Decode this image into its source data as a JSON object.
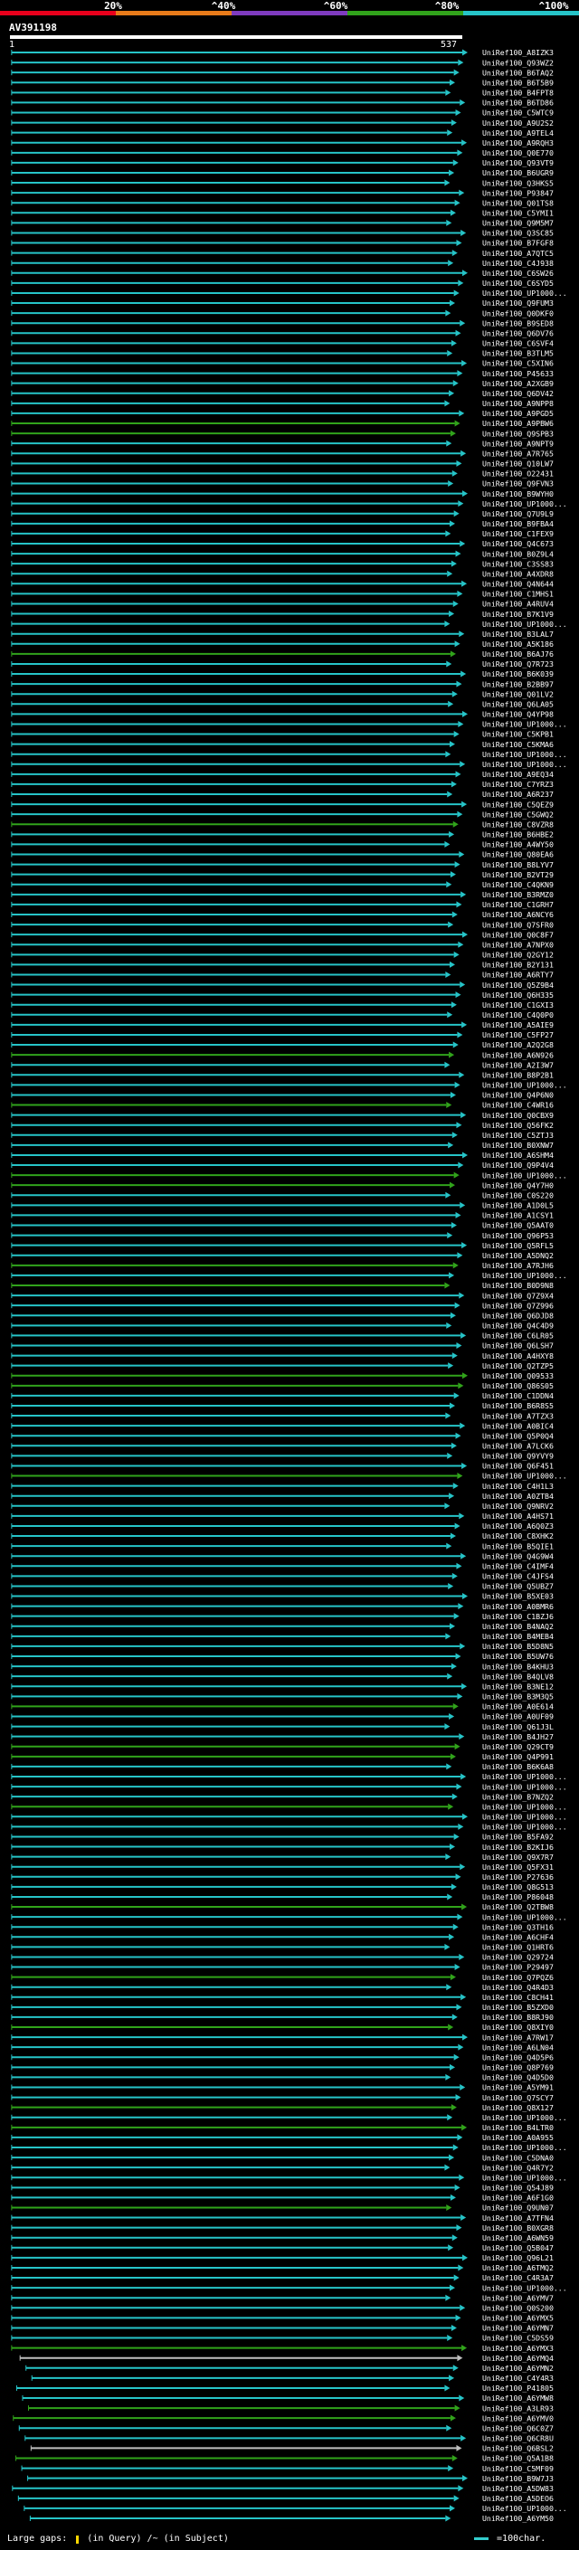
{
  "chart_data": {
    "type": "alignment-map",
    "title": "",
    "query_id": "AV391198",
    "query_start_label": "1",
    "query_end_label": "537",
    "identity_scale": {
      "ticks": [
        "20%",
        "^40%",
        "^60%",
        "^80%",
        "^100%"
      ],
      "band_colors": [
        "#e8001c",
        "#e87b1a",
        "#7f3bbf",
        "#31a31b",
        "#26c4c8"
      ]
    },
    "hits": [
      "UniRef100_A8IZK3",
      "UniRef100_Q93WZ2",
      "UniRef100_B6TAQ2",
      "UniRef100_B6T5B9",
      "UniRef100_B4FPT8",
      "UniRef100_B6TD86",
      "UniRef100_C5WTC9",
      "UniRef100_A9U2S2",
      "UniRef100_A9TEL4",
      "UniRef100_A9RQH3",
      "UniRef100_Q0E770",
      "UniRef100_Q93VT9",
      "UniRef100_B6UGR9",
      "UniRef100_Q3HKS5",
      "UniRef100_P93847",
      "UniRef100_Q01TS8",
      "UniRef100_C5YMI1",
      "UniRef100_Q9M5M7",
      "UniRef100_Q3SC85",
      "UniRef100_B7FGF8",
      "UniRef100_A7QTC5",
      "UniRef100_C4J938",
      "UniRef100_C6SW26",
      "UniRef100_C6SYD5",
      "UniRef100_UP1000...",
      "UniRef100_Q9FUM3",
      "UniRef100_Q0DKF0",
      "UniRef100_B9SED8",
      "UniRef100_Q6DV76",
      "UniRef100_C6SVF4",
      "UniRef100_B3TLM5",
      "UniRef100_C5XIN6",
      "UniRef100_P45633",
      "UniRef100_A2XGB9",
      "UniRef100_Q6DV42",
      "UniRef100_A9NPP8",
      "UniRef100_A9PGD5",
      "UniRef100_A9PBW6",
      "UniRef100_Q9SPB3",
      "UniRef100_A9NPT9",
      "UniRef100_A7R765",
      "UniRef100_Q10LW7",
      "UniRef100_O22431",
      "UniRef100_Q9FVN3",
      "UniRef100_B9WYH0",
      "UniRef100_UP1000...",
      "UniRef100_Q7U9L9",
      "UniRef100_B9FBA4",
      "UniRef100_C1FEX9",
      "UniRef100_Q4C673",
      "UniRef100_B0Z9L4",
      "UniRef100_C3SS83",
      "UniRef100_A4XDR8",
      "UniRef100_Q4N644",
      "UniRef100_C1MHS1",
      "UniRef100_A4RUV4",
      "UniRef100_B7K1V9",
      "UniRef100_UP1000...",
      "UniRef100_B3LAL7",
      "UniRef100_A5K186",
      "UniRef100_B6AJ76",
      "UniRef100_Q7R723",
      "UniRef100_B6K039",
      "UniRef100_B2BB97",
      "UniRef100_Q01LV2",
      "UniRef100_Q6LA05",
      "UniRef100_Q4YP98",
      "UniRef100_UP1000...",
      "UniRef100_C5KPB1",
      "UniRef100_C5KMA6",
      "UniRef100_UP1000...",
      "UniRef100_UP1000...",
      "UniRef100_A9EQ34",
      "UniRef100_C7YRZ3",
      "UniRef100_A6R237",
      "UniRef100_C5QEZ9",
      "UniRef100_C5GWQ2",
      "UniRef100_C8VZR8",
      "UniRef100_B6HBE2",
      "UniRef100_A4WY50",
      "UniRef100_Q80EA6",
      "UniRef100_B8LYV7",
      "UniRef100_B2VT29",
      "UniRef100_C4QKN9",
      "UniRef100_B3RMZ0",
      "UniRef100_C1GRH7",
      "UniRef100_A6NCY6",
      "UniRef100_Q7SFR0",
      "UniRef100_Q0C8F7",
      "UniRef100_A7NPX0",
      "UniRef100_Q2GY12",
      "UniRef100_B2Y131",
      "UniRef100_A6RTY7",
      "UniRef100_Q5Z9B4",
      "UniRef100_Q6H335",
      "UniRef100_C1GXI3",
      "UniRef100_C4Q0P0",
      "UniRef100_A5AIE9",
      "UniRef100_C5FP27",
      "UniRef100_A2Q2G8",
      "UniRef100_A6N926",
      "UniRef100_A2I3W7",
      "UniRef100_B8P2B1",
      "UniRef100_UP1000...",
      "UniRef100_Q4P6N0",
      "UniRef100_C4WR16",
      "UniRef100_Q0CBX9",
      "UniRef100_Q56FK2",
      "UniRef100_C5ZTJ3",
      "UniRef100_B0XNW7",
      "UniRef100_A6SHM4",
      "UniRef100_Q9P4V4",
      "UniRef100_UP1000...",
      "UniRef100_Q4Y7H0",
      "UniRef100_C0S220",
      "UniRef100_A1D0L5",
      "UniRef100_A1CSY1",
      "UniRef100_Q5AAT0",
      "UniRef100_Q96P53",
      "UniRef100_Q5RFL5",
      "UniRef100_A5DNQ2",
      "UniRef100_A7RJH6",
      "UniRef100_UP1000...",
      "UniRef100_B0D9N8",
      "UniRef100_Q7Z9X4",
      "UniRef100_Q7Z996",
      "UniRef100_Q6DJD8",
      "UniRef100_Q4C4D9",
      "UniRef100_C6LR05",
      "UniRef100_Q6LSH7",
      "UniRef100_A4HXY8",
      "UniRef100_Q2TZP5",
      "UniRef100_Q09533",
      "UniRef100_Q86S05",
      "UniRef100_C1DDN4",
      "UniRef100_B6R8S5",
      "UniRef100_A7TZX3",
      "UniRef100_A0BIC4",
      "UniRef100_Q5P0Q4",
      "UniRef100_A7LCK6",
      "UniRef100_Q9YVY9",
      "UniRef100_Q6F451",
      "UniRef100_UP1000...",
      "UniRef100_C4H1L3",
      "UniRef100_A0ZTB4",
      "UniRef100_Q9NRV2",
      "UniRef100_A4HS71",
      "UniRef100_A6Q0Z3",
      "UniRef100_C8XHK2",
      "UniRef100_B5QIE1",
      "UniRef100_Q4G9W4",
      "UniRef100_C4IMF4",
      "UniRef100_C4JFS4",
      "UniRef100_Q5UBZ7",
      "UniRef100_B5XE03",
      "UniRef100_A0BMR6",
      "UniRef100_C1BZJ6",
      "UniRef100_B4NAQ2",
      "UniRef100_B4MEB4",
      "UniRef100_B5D8N5",
      "UniRef100_B5UW76",
      "UniRef100_B4KHU3",
      "UniRef100_B4QLV8",
      "UniRef100_B3NE12",
      "UniRef100_B3M3Q5",
      "UniRef100_A0E614",
      "UniRef100_A0UF09",
      "UniRef100_Q61J3L",
      "UniRef100_B4JH27",
      "UniRef100_Q29CT9",
      "UniRef100_Q4P991",
      "UniRef100_B6K6A8",
      "UniRef100_UP1000...",
      "UniRef100_UP1000...",
      "UniRef100_B7NZQ2",
      "UniRef100_UP1000...",
      "UniRef100_UP1000...",
      "UniRef100_UP1000...",
      "UniRef100_B5FA92",
      "UniRef100_B2KIJ6",
      "UniRef100_Q9X7R7",
      "UniRef100_Q5FX31",
      "UniRef100_P27636",
      "UniRef100_Q8G513",
      "UniRef100_P86048",
      "UniRef100_Q2TBW8",
      "UniRef100_UP1000...",
      "UniRef100_Q3TH16",
      "UniRef100_A6CHF4",
      "UniRef100_Q1HRT6",
      "UniRef100_Q29724",
      "UniRef100_P29497",
      "UniRef100_Q7PQZ6",
      "UniRef100_Q4R4D3",
      "UniRef100_C8CH41",
      "UniRef100_B5ZXD0",
      "UniRef100_B8RJ90",
      "UniRef100_Q8XIY0",
      "UniRef100_A7RW17",
      "UniRef100_A6LN04",
      "UniRef100_Q4D5P6",
      "UniRef100_Q8P769",
      "UniRef100_Q4D5D0",
      "UniRef100_A5YM91",
      "UniRef100_Q7SCY7",
      "UniRef100_Q8X127",
      "UniRef100_UP1000...",
      "UniRef100_B4LTR0",
      "UniRef100_A0A955",
      "UniRef100_UP1000...",
      "UniRef100_C5DNA0",
      "UniRef100_Q4R7Y2",
      "UniRef100_UP1000...",
      "UniRef100_Q54J89",
      "UniRef100_A6F1G0",
      "UniRef100_Q9UN07",
      "UniRef100_A7TFN4",
      "UniRef100_B0XGR8",
      "UniRef100_A6WN59",
      "UniRef100_Q5B047",
      "UniRef100_Q96L21",
      "UniRef100_A6TMQ2",
      "UniRef100_C4R3A7",
      "UniRef100_UP1000...",
      "UniRef100_A6YMV7",
      "UniRef100_Q0S200",
      "UniRef100_A6YMX5",
      "UniRef100_A6YMN7",
      "UniRef100_C5DS59",
      "UniRef100_A6YMX3",
      "UniRef100_A6YMQ4",
      "UniRef100_A6YMN2",
      "UniRef100_C4Y4R3",
      "UniRef100_P41805",
      "UniRef100_A6YMW8",
      "UniRef100_A3LR93",
      "UniRef100_A6YMV0",
      "UniRef100_Q6C0Z7",
      "UniRef100_Q6CR8U",
      "UniRef100_Q6BSL2",
      "UniRef100_Q5A1B8",
      "UniRef100_C5MF09",
      "UniRef100_B9W7J3",
      "UniRef100_A5DW83",
      "UniRef100_A5DEO6",
      "UniRef100_UP1000...",
      "UniRef100_A6YM50"
    ],
    "green_rows": [
      37,
      38,
      60,
      77,
      100,
      105,
      112,
      113,
      121,
      123,
      132,
      133,
      142,
      165,
      169,
      170,
      175,
      185,
      192,
      197,
      205,
      207,
      215,
      229,
      235,
      236,
      240,
      248,
      252,
      255,
      258,
      259,
      263,
      268,
      269,
      272,
      276,
      278,
      281,
      283,
      285,
      287,
      290,
      295
    ],
    "gray_rows": [
      230,
      239,
      251,
      261
    ],
    "legend": {
      "gaps_label": "Large gaps:",
      "gaps_in_query": "(in Query)",
      "gaps_in_subject": "/~ (in Subject)",
      "scale_label": "=100char."
    }
  }
}
